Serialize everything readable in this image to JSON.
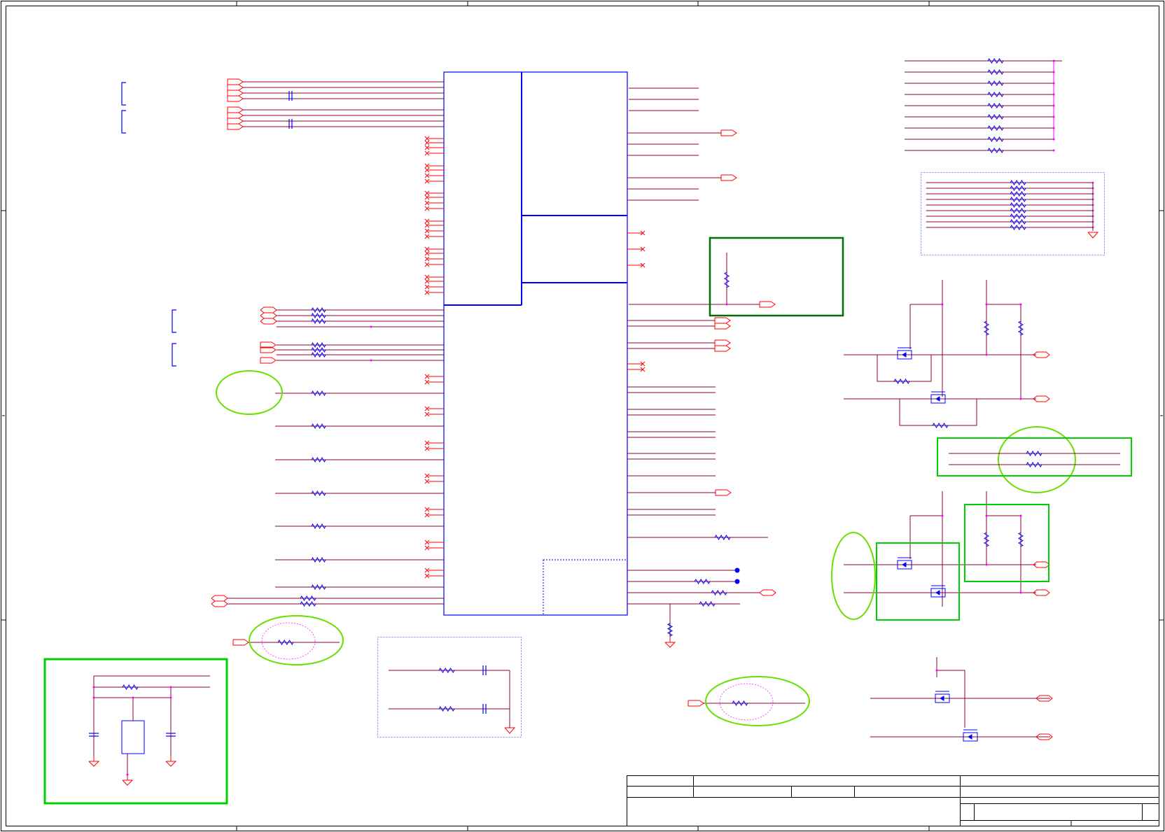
{
  "colors": {
    "background": "#ffffff",
    "frame": "#000000",
    "wire": "#8b0036",
    "pin": "#ff0000",
    "component": "#0000ff",
    "junction": "#ff00ff",
    "guide_dashed": "#5555ff",
    "highlight_green": "#00d000",
    "highlight_dark_green": "#007000",
    "highlight_light_green": "#66e000"
  },
  "diagram": {
    "kind": "electrical-schematic-sheet",
    "text_labels": []
  }
}
